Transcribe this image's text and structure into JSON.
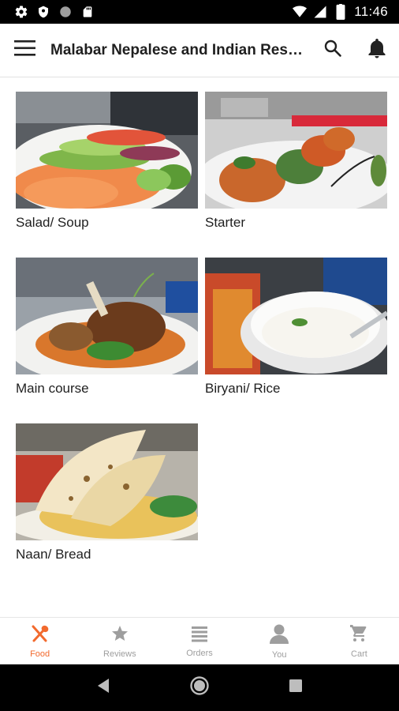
{
  "status_bar": {
    "time": "11:46",
    "left_icons": [
      "settings-icon",
      "shield-icon",
      "circle-icon",
      "sd-card-icon"
    ],
    "right_icons": [
      "wifi-icon",
      "signal-icon",
      "battery-icon"
    ]
  },
  "app_bar": {
    "title": "Malabar Nepalese and Indian Resta...",
    "menu_icon": "hamburger-menu-icon",
    "search_icon": "search-icon",
    "notification_icon": "bell-icon"
  },
  "categories": [
    {
      "label": "Salad/ Soup"
    },
    {
      "label": "Starter"
    },
    {
      "label": "Main course"
    },
    {
      "label": "Biryani/ Rice"
    },
    {
      "label": "Naan/ Bread"
    }
  ],
  "bottom_nav": {
    "items": [
      {
        "label": "Food",
        "icon": "fork-spoon-icon",
        "active": true
      },
      {
        "label": "Reviews",
        "icon": "star-icon",
        "active": false
      },
      {
        "label": "Orders",
        "icon": "orders-list-icon",
        "active": false
      },
      {
        "label": "You",
        "icon": "person-icon",
        "active": false
      },
      {
        "label": "Cart",
        "icon": "cart-icon",
        "active": false
      }
    ]
  },
  "colors": {
    "accent": "#f26a2e",
    "inactive": "#9e9e9e",
    "text": "#1f1f1f"
  }
}
